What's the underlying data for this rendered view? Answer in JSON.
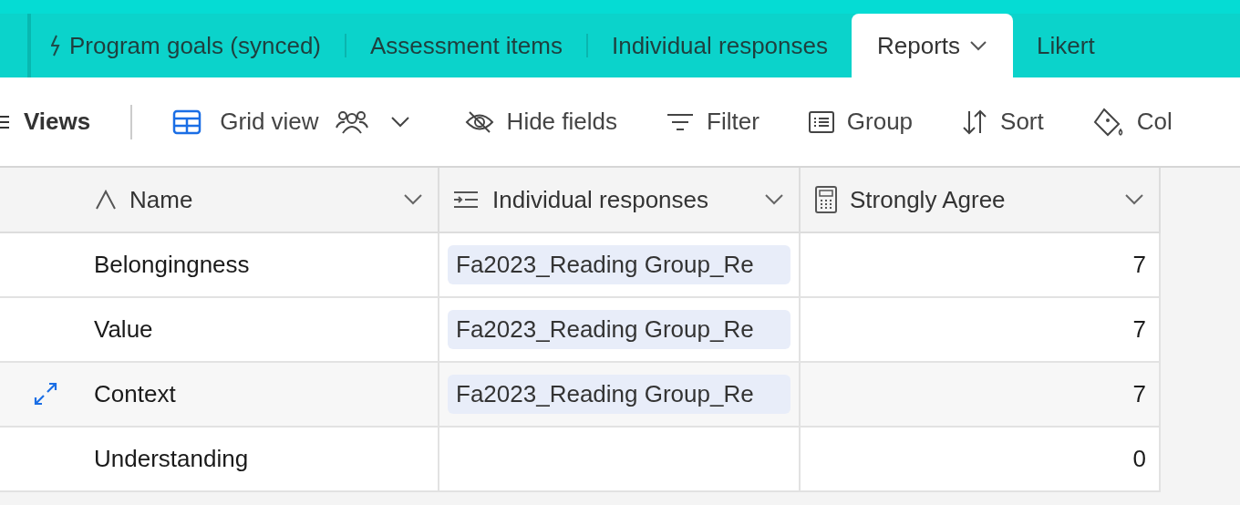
{
  "tabs": [
    {
      "label": "Program goals (synced)",
      "selected": false,
      "synced": true,
      "dropdown": false
    },
    {
      "label": "Assessment items",
      "selected": false,
      "synced": false,
      "dropdown": false
    },
    {
      "label": "Individual responses",
      "selected": false,
      "synced": false,
      "dropdown": false
    },
    {
      "label": "Reports",
      "selected": true,
      "synced": false,
      "dropdown": true
    },
    {
      "label": "Likert",
      "selected": false,
      "synced": false,
      "dropdown": false
    }
  ],
  "toolbar": {
    "views": "Views",
    "view_name": "Grid view",
    "items": [
      {
        "kind": "hide",
        "label": "Hide fields"
      },
      {
        "kind": "filter",
        "label": "Filter"
      },
      {
        "kind": "group",
        "label": "Group"
      },
      {
        "kind": "sort",
        "label": "Sort"
      },
      {
        "kind": "color",
        "label": "Col"
      }
    ]
  },
  "table": {
    "columns": [
      {
        "kind": "text",
        "label": "Name"
      },
      {
        "kind": "link",
        "label": "Individual responses"
      },
      {
        "kind": "formula",
        "label": "Strongly Agree"
      }
    ],
    "rows": [
      {
        "name": "Belongingness",
        "link": "Fa2023_Reading Group_Re",
        "count": "7",
        "hovered": false
      },
      {
        "name": "Value",
        "link": "Fa2023_Reading Group_Re",
        "count": "7",
        "hovered": false
      },
      {
        "name": "Context",
        "link": "Fa2023_Reading Group_Re",
        "count": "7",
        "hovered": true
      },
      {
        "name": "Understanding",
        "link": "",
        "count": "0",
        "hovered": false
      }
    ]
  }
}
